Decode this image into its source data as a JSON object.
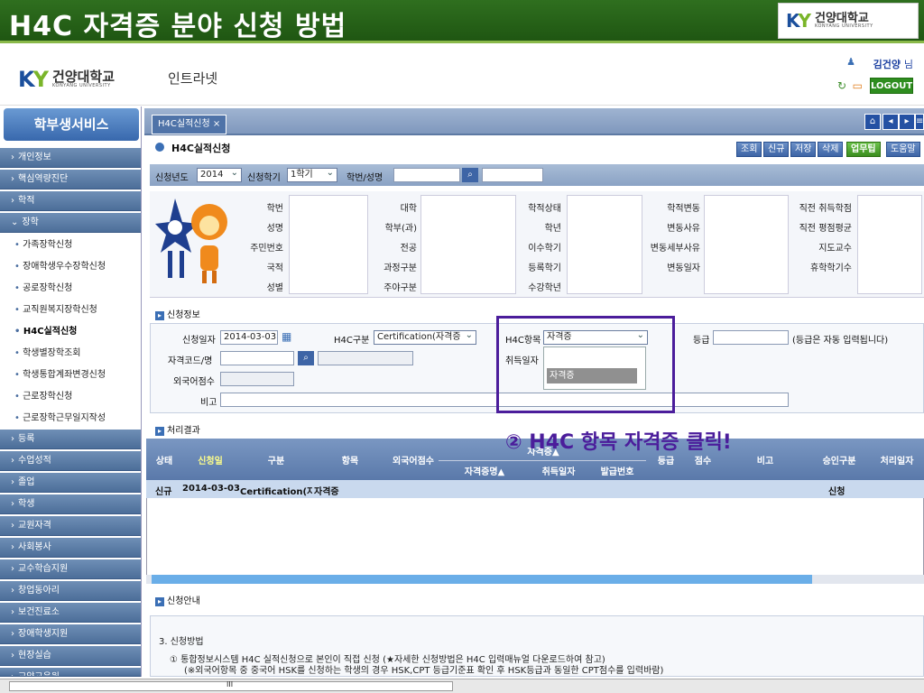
{
  "slide": {
    "title": "H4C 자격증 분야 신청 방법",
    "logo_ko": "건양대학교",
    "logo_en": "KONYANG UNIVERSITY",
    "logo_mark_k": "K",
    "logo_mark_y": "Y"
  },
  "header": {
    "app_name": "인트라넷",
    "user_name": "김건양",
    "user_suffix": "님",
    "logout": "LOGOUT"
  },
  "sidebar": {
    "title": "학부생서비스",
    "top_items": [
      "개인정보",
      "핵심역량진단",
      "학적",
      "장학"
    ],
    "sub_items": [
      "가족장학신청",
      "장애학생우수장학신청",
      "공로장학신청",
      "교직원복지장학신청",
      "H4C실적신청",
      "학생별장학조회",
      "학생통합계좌변경신청",
      "근로장학신청",
      "근로장학근무일지작성"
    ],
    "bottom_items": [
      "등록",
      "수업성적",
      "졸업",
      "학생",
      "교원자격",
      "사회봉사",
      "교수학습지원",
      "창업동아리",
      "보건진료소",
      "장애학생지원",
      "현장실습",
      "교양교육원"
    ]
  },
  "tab": {
    "label": "H4C실적신청",
    "close": "×"
  },
  "page": {
    "title": "H4C실적신청",
    "buttons": [
      "조회",
      "신규",
      "저장",
      "삭제",
      "업무팁",
      "도움말"
    ]
  },
  "filter": {
    "year_label": "신청년도",
    "year": "2014",
    "term_label": "신청학기",
    "term": "1학기",
    "student_label": "학번/성명"
  },
  "info_labels": {
    "col1": [
      "학번",
      "성명",
      "주민번호",
      "국적",
      "성별"
    ],
    "col2": [
      "대학",
      "학부(과)",
      "전공",
      "과정구분",
      "주야구분"
    ],
    "col3": [
      "학적상태",
      "학년",
      "이수학기",
      "등록학기",
      "수강학년"
    ],
    "col4": [
      "학적변동",
      "변동사유",
      "변동세부사유",
      "변동일자"
    ],
    "col5": [
      "직전 취득학점",
      "직전 평점평균",
      "지도교수",
      "휴학학기수"
    ]
  },
  "apply": {
    "section": "신청정보",
    "date_label": "신청일자",
    "date": "2014-03-03",
    "type_label": "H4C구분",
    "type": "Certification(자격증",
    "item_label": "H4C항목",
    "item": "자격증",
    "grade_label": "등급",
    "grade_note": "(등급은 자동 입력됩니다)",
    "code_label": "자격코드/명",
    "acq_label": "취득일자",
    "foreign_label": "외국어점수",
    "note_label": "비고",
    "dropdown_option": "자격증"
  },
  "annotation": "② H4C 항목 자격증 클릭!",
  "results": {
    "section": "처리결과",
    "headers": {
      "status": "상태",
      "date": "신청일",
      "type": "구분",
      "item": "항목",
      "foreign": "외국어점수",
      "cert_group": "자격증▲",
      "cert_name": "자격증명▲",
      "acq": "취득일자",
      "issue": "발급번호",
      "grade": "등급",
      "score": "점수",
      "note": "비고",
      "approval": "승인구분",
      "proc": "처리일자"
    },
    "row": {
      "status": "신규",
      "date": "2014-03-03",
      "type": "Certification(자",
      "item": "자격증",
      "approval": "신청"
    }
  },
  "guide": {
    "section": "신청안내",
    "heading": "3. 신청방법",
    "line1": "① 통합정보시스템 H4C 실적신청으로 본인이 직접 신청 (★자세한 신청방법은 H4C 입력매뉴얼 다운로드하여 참고)",
    "line2": "(※외국어항목 중 중국어 HSK를 신청하는 학생의 경우 HSK,CPT 등급기준표 확인 후 HSK등급과 동일한 CPT점수를 입력바람)"
  },
  "scroll_mark": "III",
  "icons": {
    "user": "person-icon",
    "refresh": "refresh-icon",
    "window": "window-icon",
    "home": "home-icon",
    "calendar": "calendar-icon",
    "search": "search-icon"
  }
}
